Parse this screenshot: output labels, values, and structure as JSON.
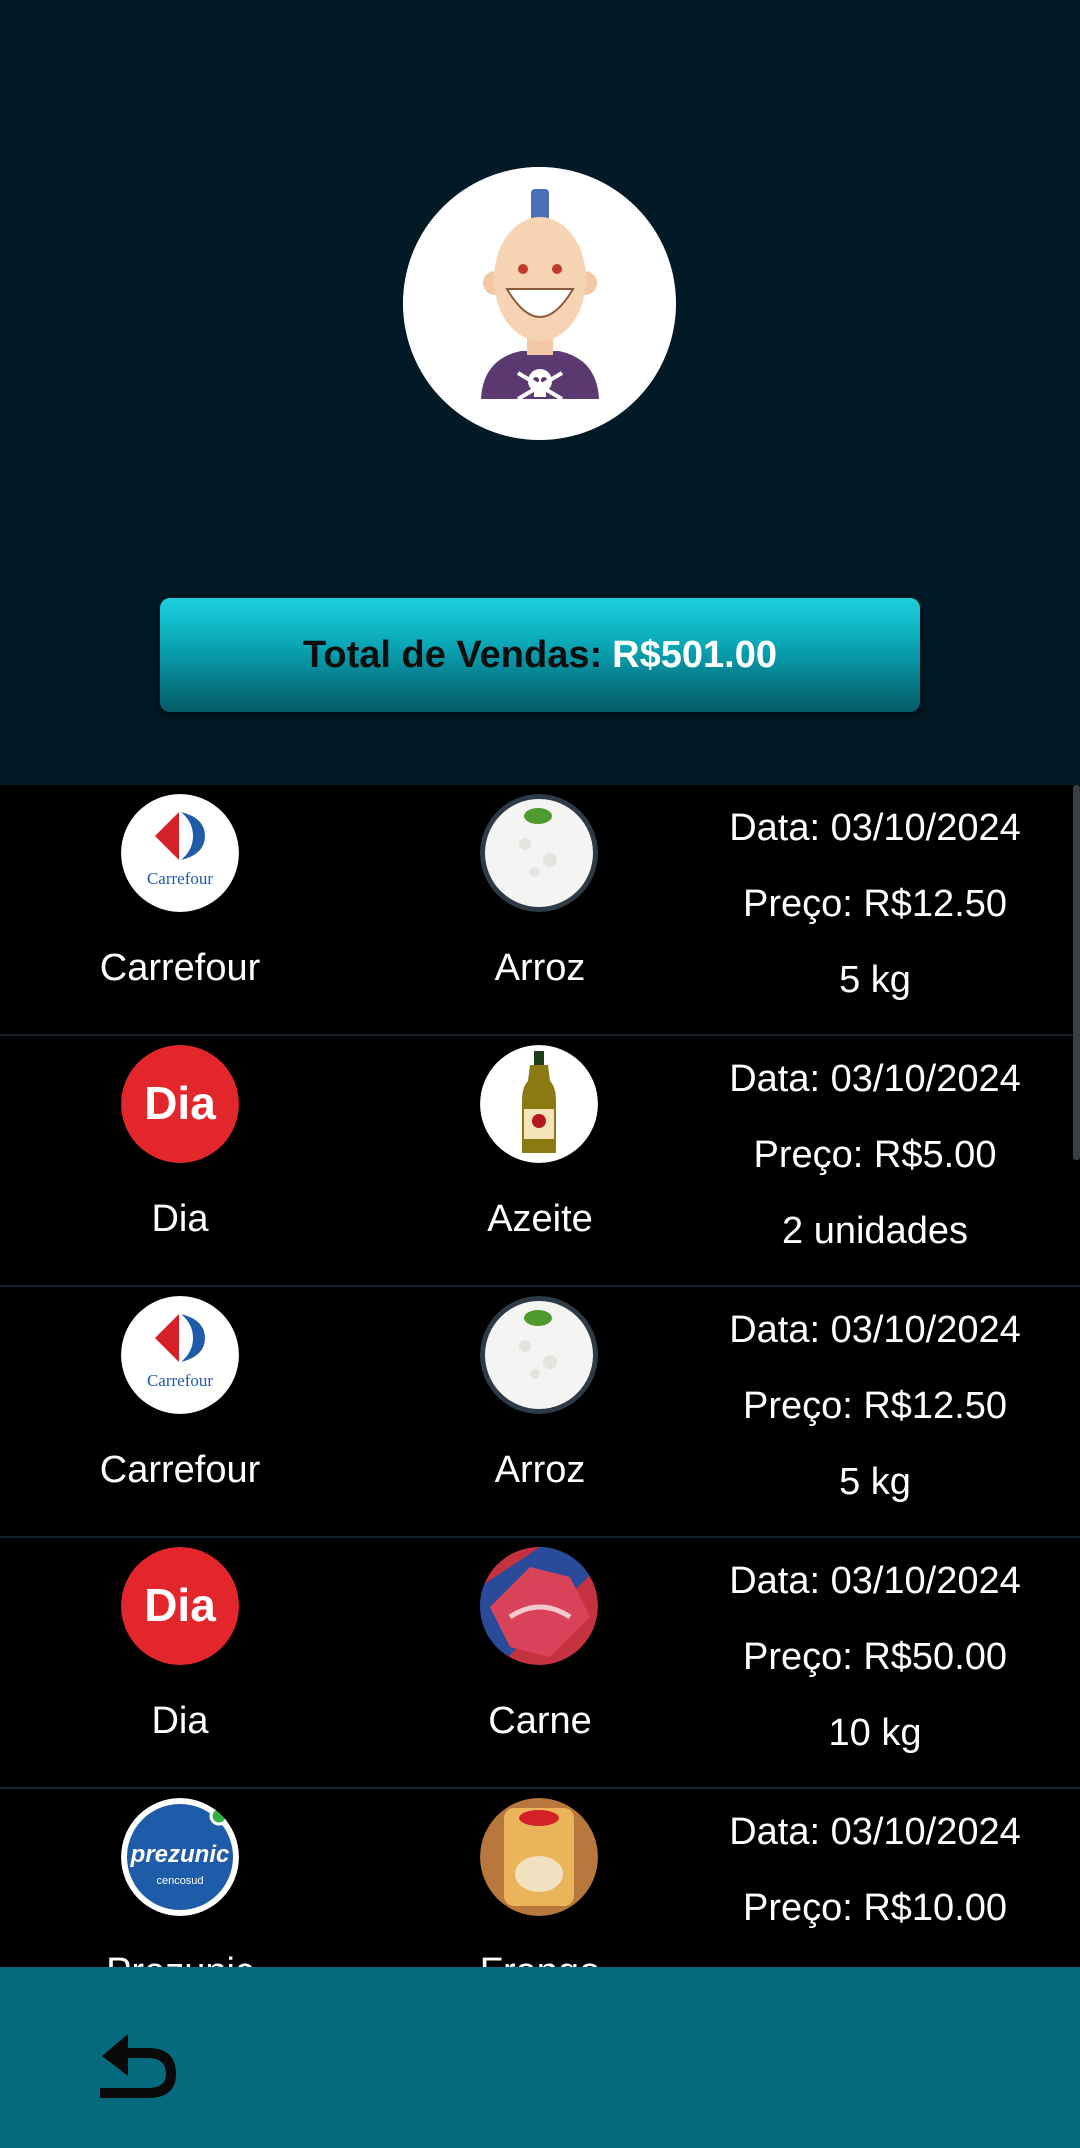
{
  "header": {
    "avatar_icon": "avatar-icon",
    "total_label": "Total de Vendas:",
    "total_value": "R$501.00"
  },
  "sales": [
    {
      "store": "Carrefour",
      "store_icon": "carrefour-logo-icon",
      "product": "Arroz",
      "product_icon": "rice-bowl-icon",
      "date": "Data: 03/10/2024",
      "price": "Preço: R$12.50",
      "qty": "5 kg"
    },
    {
      "store": "Dia",
      "store_icon": "dia-logo-icon",
      "product": "Azeite",
      "product_icon": "olive-oil-icon",
      "date": "Data: 03/10/2024",
      "price": "Preço: R$5.00",
      "qty": "2 unidades"
    },
    {
      "store": "Carrefour",
      "store_icon": "carrefour-logo-icon",
      "product": "Arroz",
      "product_icon": "rice-bowl-icon",
      "date": "Data: 03/10/2024",
      "price": "Preço: R$12.50",
      "qty": "5 kg"
    },
    {
      "store": "Dia",
      "store_icon": "dia-logo-icon",
      "product": "Carne",
      "product_icon": "meat-icon",
      "date": "Data: 03/10/2024",
      "price": "Preço: R$50.00",
      "qty": "10 kg"
    },
    {
      "store": "Prezunic",
      "store_icon": "prezunic-logo-icon",
      "product": "Frango",
      "product_icon": "chicken-icon",
      "date": "Data: 03/10/2024",
      "price": "Preço: R$10.00",
      "qty": ""
    }
  ],
  "footer": {
    "back_icon": "back-arrow-icon"
  },
  "colors": {
    "background": "#021A26",
    "button": "#0AAAB9",
    "footer": "#056A7D",
    "list": "#000000"
  }
}
